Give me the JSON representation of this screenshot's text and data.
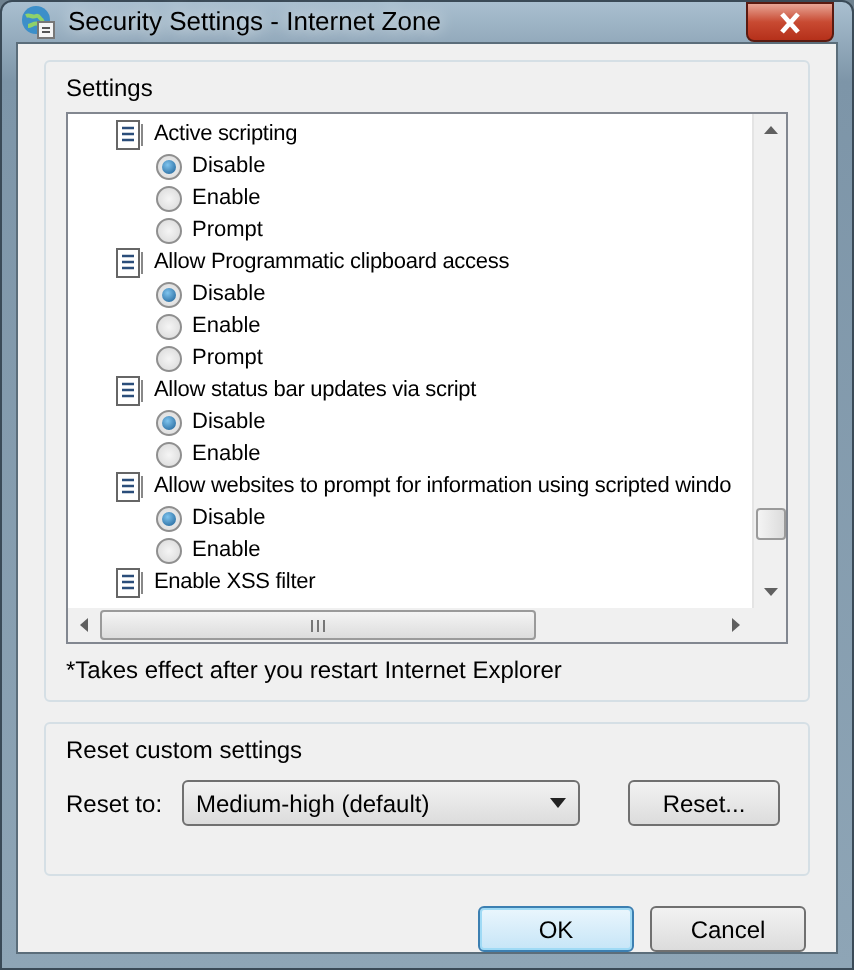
{
  "window": {
    "title": "Security Settings - Internet Zone"
  },
  "settings_group": {
    "title": "Settings",
    "items": [
      {
        "label": "Active scripting",
        "options": [
          {
            "label": "Disable",
            "selected": true
          },
          {
            "label": "Enable",
            "selected": false
          },
          {
            "label": "Prompt",
            "selected": false
          }
        ]
      },
      {
        "label": "Allow Programmatic clipboard access",
        "options": [
          {
            "label": "Disable",
            "selected": true
          },
          {
            "label": "Enable",
            "selected": false
          },
          {
            "label": "Prompt",
            "selected": false
          }
        ]
      },
      {
        "label": "Allow status bar updates via script",
        "options": [
          {
            "label": "Disable",
            "selected": true
          },
          {
            "label": "Enable",
            "selected": false
          }
        ]
      },
      {
        "label": "Allow websites to prompt for information using scripted windo",
        "options": [
          {
            "label": "Disable",
            "selected": true
          },
          {
            "label": "Enable",
            "selected": false
          }
        ]
      },
      {
        "label": "Enable XSS filter"
      }
    ],
    "note": "*Takes effect after you restart Internet Explorer"
  },
  "reset_group": {
    "title": "Reset custom settings",
    "label": "Reset to:",
    "value": "Medium-high (default)",
    "button": "Reset..."
  },
  "buttons": [
    {
      "label": "OK",
      "kind": "default"
    },
    {
      "label": "Cancel",
      "kind": "normal"
    }
  ]
}
